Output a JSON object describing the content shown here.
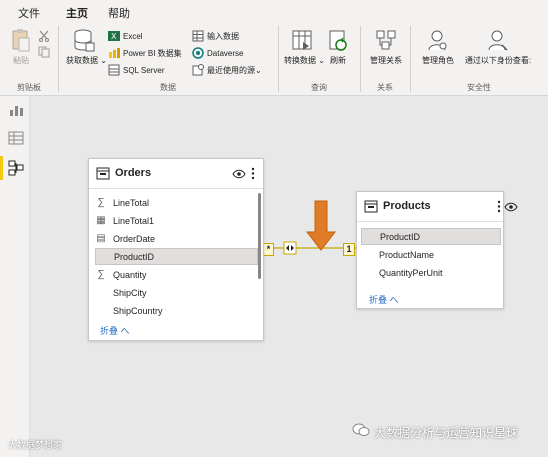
{
  "menu": {
    "file": "文件",
    "home": "主页",
    "help": "帮助"
  },
  "ribbon": {
    "clipboard": {
      "paste": "粘贴",
      "group": "剪贴板"
    },
    "data": {
      "get_data": "获取数据",
      "excel": "Excel",
      "powerbi": "Power BI 数据集",
      "sql": "SQL Server",
      "enter_data": "输入数据",
      "dataverse": "Dataverse",
      "recent": "最近使用的源",
      "group": "数据"
    },
    "query": {
      "transform": "转换数据",
      "refresh": "刷新",
      "group": "查询"
    },
    "relationships": {
      "manage": "管理关系",
      "group": "关系"
    },
    "security": {
      "manage_roles": "管理角色",
      "view_as": "通过以下身份查看:",
      "group": "安全性"
    }
  },
  "orders": {
    "title": "Orders",
    "fields": [
      {
        "icon": "sigma",
        "name": "LineTotal"
      },
      {
        "icon": "calc",
        "name": "LineTotal1"
      },
      {
        "icon": "calendar",
        "name": "OrderDate"
      },
      {
        "icon": "none",
        "name": "ProductID"
      },
      {
        "icon": "sigma",
        "name": "Quantity"
      },
      {
        "icon": "none",
        "name": "ShipCity"
      },
      {
        "icon": "none",
        "name": "ShipCountry"
      }
    ],
    "collapse": "折叠 へ"
  },
  "products": {
    "title": "Products",
    "fields": [
      {
        "name": "ProductID"
      },
      {
        "name": "ProductName"
      },
      {
        "name": "QuantityPerUnit"
      }
    ],
    "collapse": "折叠 へ"
  },
  "relationship": {
    "many": "*",
    "one": "1"
  },
  "watermark": {
    "left": "大数据梦想家",
    "right": "大数据分析与运营知识星球"
  },
  "colors": {
    "accent": "#f2c811",
    "arrow": "#e07b27",
    "link": "#2b6cc4"
  }
}
